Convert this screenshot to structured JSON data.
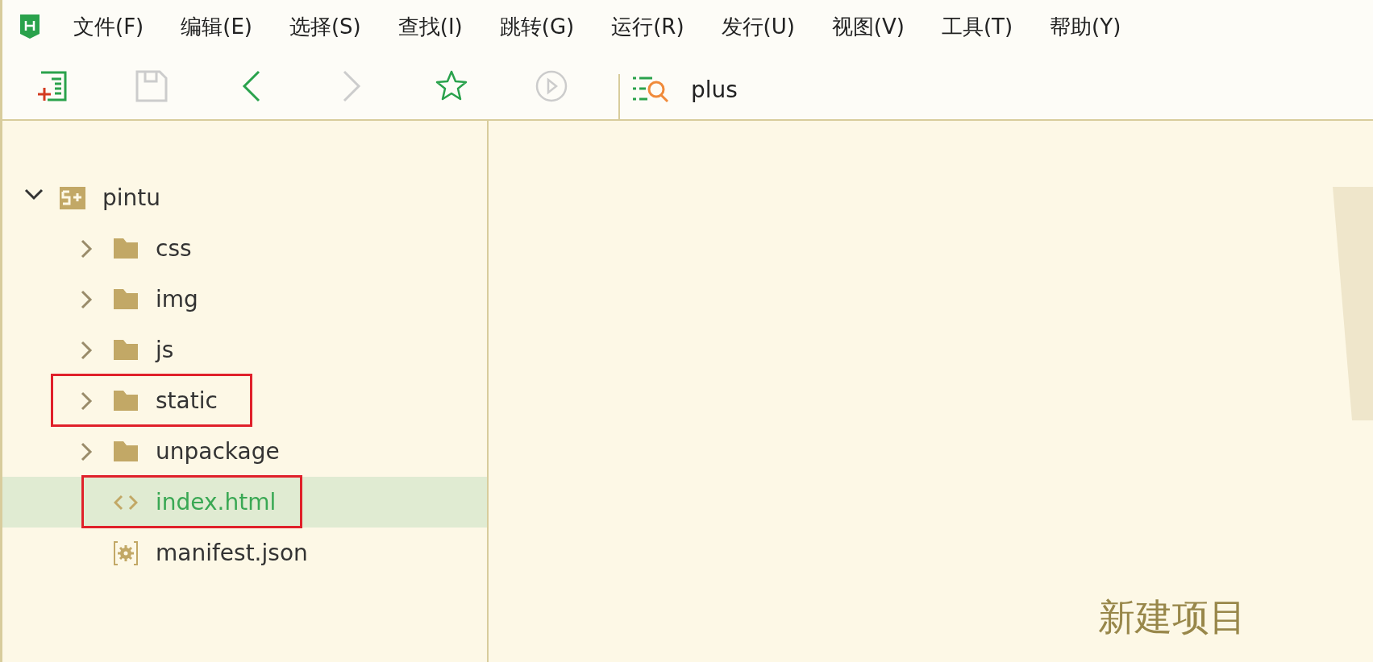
{
  "menu_bar": {
    "items": [
      "文件(F)",
      "编辑(E)",
      "选择(S)",
      "查找(I)",
      "跳转(G)",
      "运行(R)",
      "发行(U)",
      "视图(V)",
      "工具(T)",
      "帮助(Y)"
    ]
  },
  "toolbar": {
    "buttons": [
      {
        "kind": "new",
        "disabled": false
      },
      {
        "kind": "save",
        "disabled": true
      },
      {
        "kind": "back",
        "disabled": false
      },
      {
        "kind": "forward",
        "disabled": true
      },
      {
        "kind": "favorite",
        "disabled": false
      },
      {
        "kind": "run",
        "disabled": true
      }
    ],
    "search": {
      "value": "plus"
    }
  },
  "project_tree": [
    {
      "label": "pintu",
      "kind": "project",
      "expanded": true,
      "selected": false,
      "annotated": false,
      "children": [
        {
          "label": "css",
          "kind": "folder",
          "expanded": false,
          "selected": false,
          "annotated": false
        },
        {
          "label": "img",
          "kind": "folder",
          "expanded": false,
          "selected": false,
          "annotated": false
        },
        {
          "label": "js",
          "kind": "folder",
          "expanded": false,
          "selected": false,
          "annotated": false
        },
        {
          "label": "static",
          "kind": "folder",
          "expanded": false,
          "selected": false,
          "annotated": true
        },
        {
          "label": "unpackage",
          "kind": "folder",
          "expanded": false,
          "selected": false,
          "annotated": false
        },
        {
          "label": "index.html",
          "kind": "html",
          "selected": true,
          "annotated": true
        },
        {
          "label": "manifest.json",
          "kind": "manifest",
          "selected": false,
          "annotated": false
        }
      ]
    }
  ],
  "editor": {
    "link": "新建项目"
  }
}
